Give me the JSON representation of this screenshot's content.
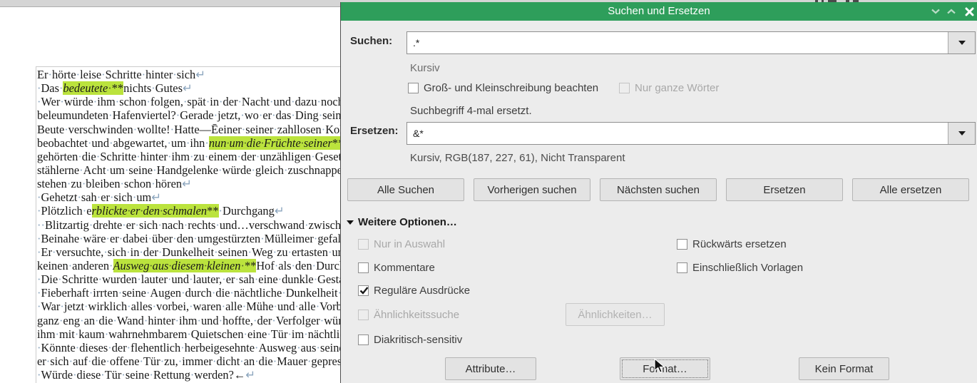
{
  "document": {
    "lines": [
      [
        [
          "p",
          "Er·hörte·leise·Schritte·hinter·sich"
        ],
        [
          "m",
          "↵"
        ]
      ],
      [
        [
          "p",
          "·Das·"
        ],
        [
          "i",
          "bedeutete"
        ],
        [
          "a",
          "·**"
        ],
        [
          "p",
          "nichts·Gutes"
        ],
        [
          "m",
          "↵"
        ]
      ],
      [
        [
          "p",
          "·Wer·würde·ihm·schon·folgen,·spät·in·der·Nacht·und·dazu·noch·in"
        ]
      ],
      [
        [
          "p",
          "beleumundeten·Hafenviertel?·Gerade·jetzt,·wo·er·das·Ding·seines"
        ]
      ],
      [
        [
          "p",
          "Beute·verschwinden·wollte!·Hatte—Ēeiner·seiner·zahllosen·Kolle"
        ]
      ],
      [
        [
          "p",
          "beobachtet·und·abgewartet,·um·ihn·"
        ],
        [
          "i",
          "nun·um·die·Früchte·seiner"
        ],
        [
          "a",
          "**"
        ],
        [
          "p",
          ","
        ]
      ],
      [
        [
          "p",
          "gehörten·die·Schritte·hinter·ihm·zu·einem·der·unzähligen·Gesetze"
        ]
      ],
      [
        [
          "p",
          "stählerne·Acht·um·seine·Handgelenke·würde·gleich·zuschnappen'"
        ]
      ],
      [
        [
          "p",
          "stehen·zu·bleiben·schon·hören"
        ],
        [
          "m",
          "↵"
        ]
      ],
      [
        [
          "p",
          "·Gehetzt·sah·er·sich·um"
        ],
        [
          "m",
          "↵"
        ]
      ],
      [
        [
          "p",
          "·Plötzlich·e"
        ],
        [
          "i",
          "rblickte·er·den·schmalen"
        ],
        [
          "a",
          "**"
        ],
        [
          "p",
          "·Durchgang"
        ],
        [
          "m",
          "↵"
        ]
      ],
      [
        [
          "p",
          "··Blitzartig·drehte·er·sich·nach·rechts·und…verschwand·zwischen"
        ]
      ],
      [
        [
          "p",
          "·Beinahe·wäre·er·dabei·über·den·umgestürzten·Mülleimer·gefallen"
        ]
      ],
      [
        [
          "p",
          "·Er·versuchte,·sich·in·der·Dunkelheit·seinen·Weg·zu·ertasten·und·"
        ]
      ],
      [
        [
          "p",
          "keinen·anderen·"
        ],
        [
          "i",
          "Ausweg·aus·diesem·kleinen"
        ],
        [
          "a",
          "·**"
        ],
        [
          "p",
          "Hof·als·den·Durchg"
        ]
      ],
      [
        [
          "p",
          "·Die·Schritte·wurden·lauter·und·lauter,·er·sah·eine·dunkle·Gestalt"
        ]
      ],
      [
        [
          "p",
          "·Fieberhaft·irrten·seine·Augen·durch·die·nächtliche·Dunkelheit·un"
        ]
      ],
      [
        [
          "p",
          "·War·jetzt·wirklich·alles·vorbei,·waren·alle·Mühe·und·alle·Vorber"
        ]
      ],
      [
        [
          "p",
          "ganz·eng·an·die·Wand·hinter·ihm·und·hoffte,·der·Verfolger·würde"
        ]
      ],
      [
        [
          "p",
          "ihm·mit·kaum·wahrnehmbarem·Quietschen·eine·Tür·im·nächtlich"
        ]
      ],
      [
        [
          "p",
          "·Könnte·dieses·der·flehentlich·herbeigesehnte·Ausweg·aus·seinem"
        ]
      ],
      [
        [
          "p",
          "er·sich·auf·die·offene·Tür·zu,·immer·dicht·an·die·Mauer·gepresst"
        ],
        [
          "m",
          "↵"
        ]
      ],
      [
        [
          "p",
          "·Würde·diese·Tür·seine·Rettung·werden?"
        ],
        [
          "b",
          "←"
        ],
        [
          "m",
          "↵"
        ]
      ]
    ],
    "highlight_color": "#bbe33d"
  },
  "dialog": {
    "title": "Suchen und Ersetzen",
    "titlebar_color": "#2e9e5b",
    "search": {
      "label": "Suchen:",
      "value": ".*",
      "format_hint": "Kursiv",
      "status": "Suchbegriff 4-mal ersetzt."
    },
    "replace": {
      "label": "Ersetzen:",
      "value": "&*",
      "format_hint": "Kursiv, RGB(187, 227, 61), Nicht Transparent"
    },
    "checkboxes": {
      "match_case": {
        "label": "Groß- und Kleinschreibung beachten",
        "checked": false,
        "disabled": false
      },
      "whole_words": {
        "label": "Nur ganze Wörter",
        "checked": false,
        "disabled": true
      },
      "selection_only": {
        "label": "Nur in Auswahl",
        "checked": false,
        "disabled": true
      },
      "backwards": {
        "label": "Rückwärts ersetzen",
        "checked": false,
        "disabled": false
      },
      "comments": {
        "label": "Kommentare",
        "checked": false,
        "disabled": false
      },
      "styles": {
        "label": "Einschließlich Vorlagen",
        "checked": false,
        "disabled": false
      },
      "regex": {
        "label": "Reguläre Ausdrücke",
        "checked": true,
        "disabled": false
      },
      "similarity": {
        "label": "Ähnlichkeitssuche",
        "checked": false,
        "disabled": true
      },
      "diacritics": {
        "label": "Diakritisch-sensitiv",
        "checked": false,
        "disabled": false
      }
    },
    "buttons_row1": [
      "Alle Suchen",
      "Vorherigen suchen",
      "Nächsten suchen",
      "Ersetzen",
      "Alle ersetzen"
    ],
    "more_options_label": "Weitere Optionen…",
    "similarity_button": "Ähnlichkeiten…",
    "bottom_buttons": {
      "attributes": "Attribute…",
      "format": "Format…",
      "no_format": "Kein Format"
    }
  }
}
